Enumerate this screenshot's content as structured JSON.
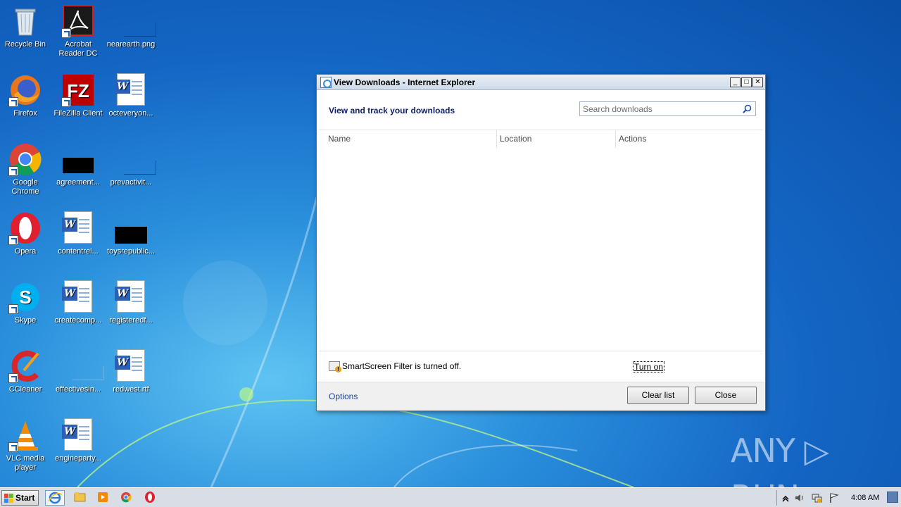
{
  "desktop": {
    "icons": [
      {
        "label": "Recycle Bin"
      },
      {
        "label": "Acrobat Reader DC"
      },
      {
        "label": "nearearth.png"
      },
      {
        "label": "Firefox"
      },
      {
        "label": "FileZilla Client"
      },
      {
        "label": "octeveryon..."
      },
      {
        "label": "Google Chrome"
      },
      {
        "label": "agreement..."
      },
      {
        "label": "prevactivit..."
      },
      {
        "label": "Opera"
      },
      {
        "label": "contentrel..."
      },
      {
        "label": "toysrepublic..."
      },
      {
        "label": "Skype"
      },
      {
        "label": "createcomp..."
      },
      {
        "label": "registeredf..."
      },
      {
        "label": "CCleaner"
      },
      {
        "label": "effectivesin..."
      },
      {
        "label": "redwest.rtf"
      },
      {
        "label": "VLC media player"
      },
      {
        "label": "engineparty..."
      }
    ]
  },
  "dialog": {
    "title": "View Downloads - Internet Explorer",
    "heading": "View and track your downloads",
    "search_placeholder": "Search downloads",
    "columns": [
      "Name",
      "Location",
      "Actions"
    ],
    "smartscreen_text": "SmartScreen Filter is turned off.",
    "turn_on_label": "Turn on",
    "options_label": "Options",
    "clear_list_label": "Clear list",
    "close_label": "Close",
    "window_buttons": {
      "minimize": "_",
      "maximize": "□",
      "close": "✕"
    }
  },
  "taskbar": {
    "start_label": "Start",
    "clock": "4:08 AM"
  },
  "watermark": {
    "text": "ANY ▷ RUN"
  }
}
